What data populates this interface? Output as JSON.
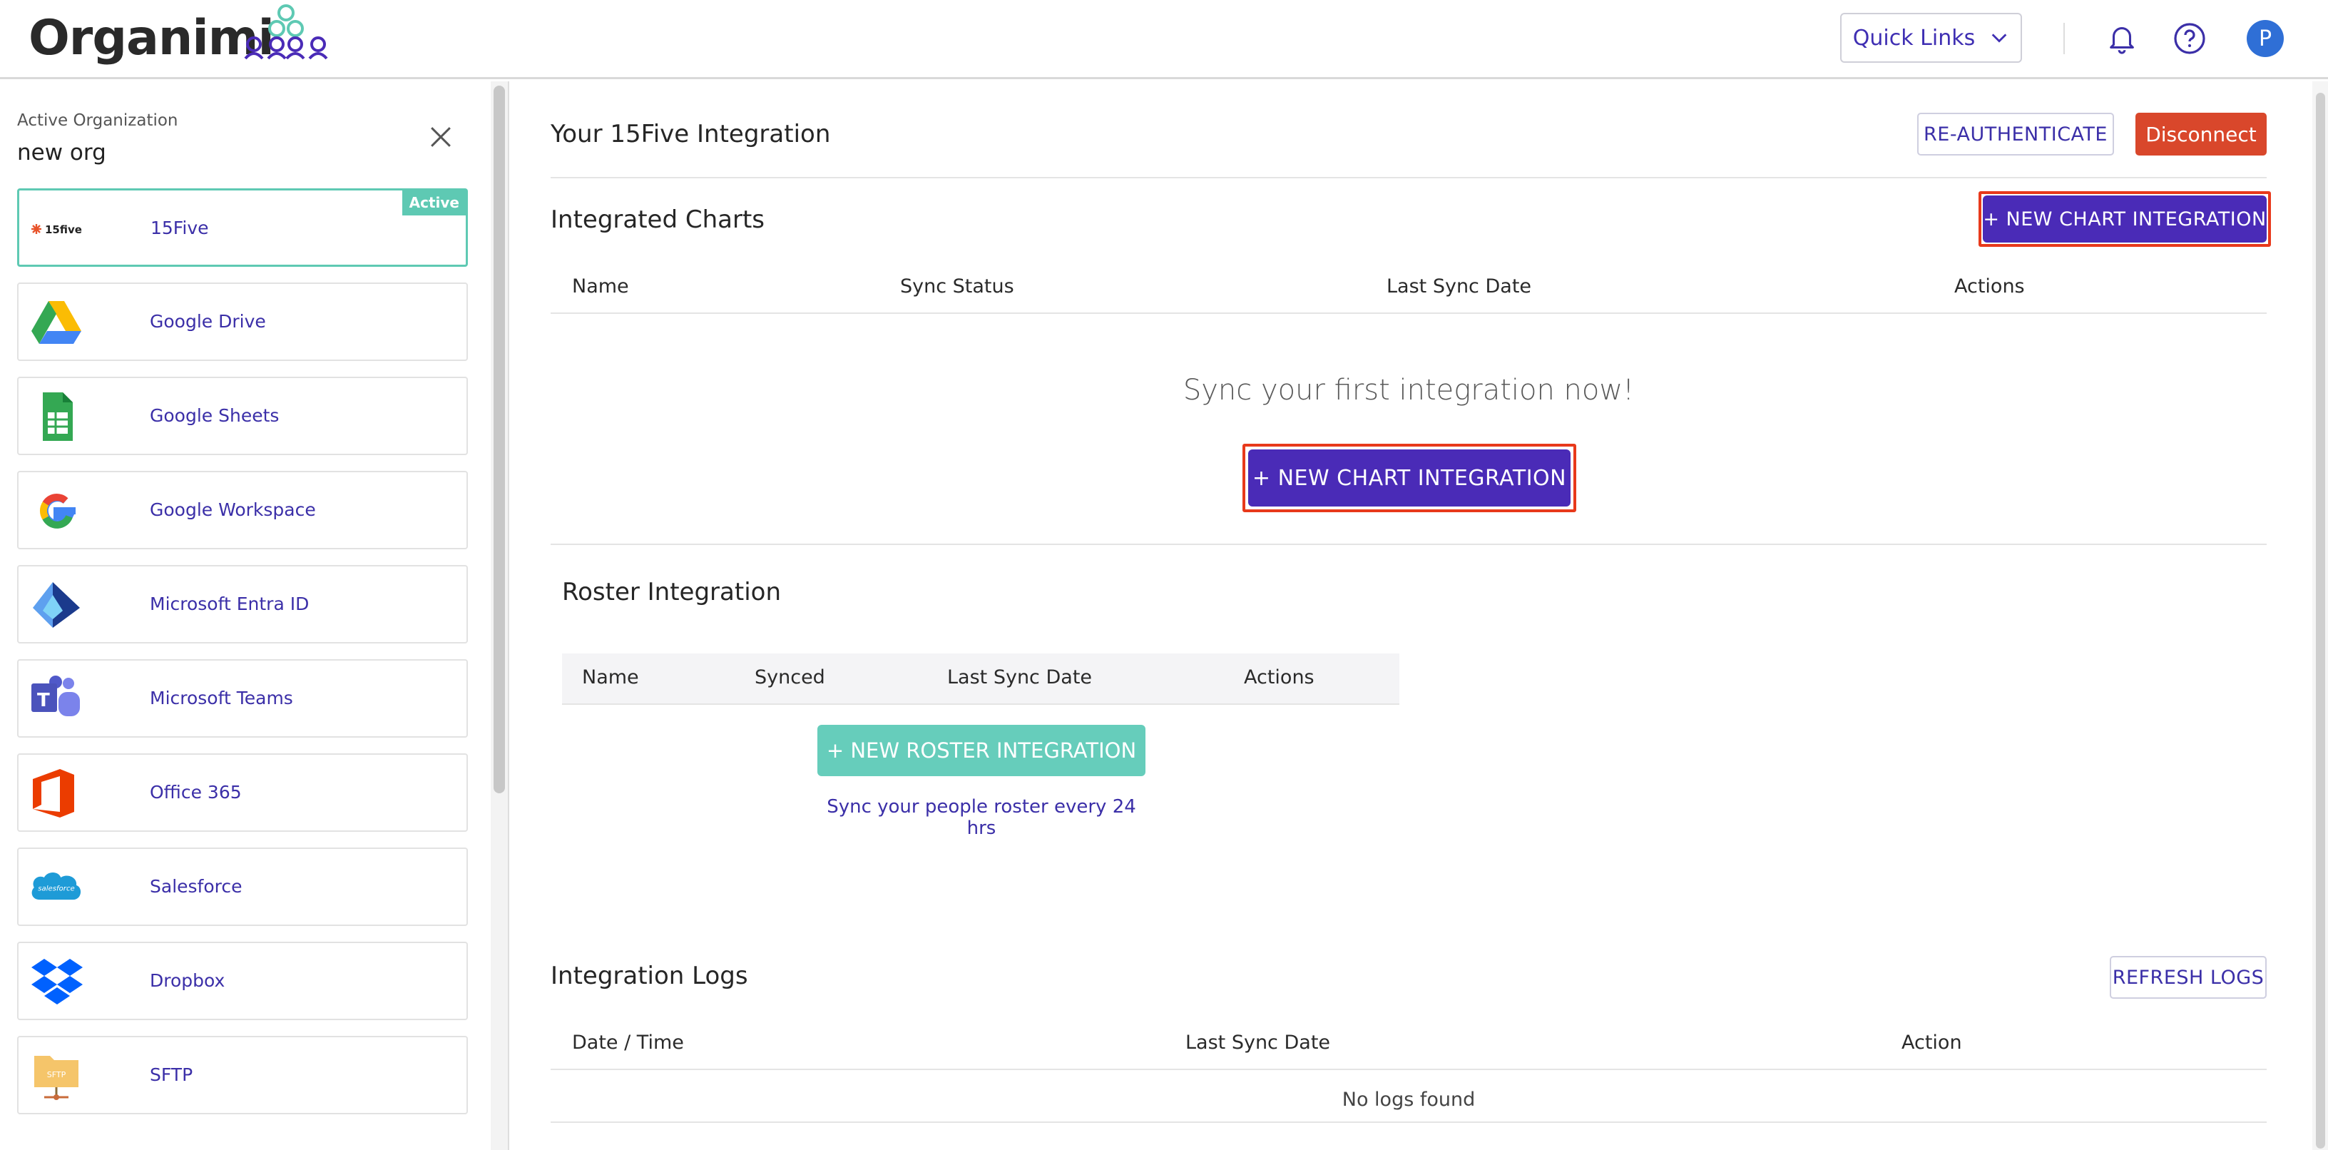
{
  "header": {
    "logo_text": "Organimi",
    "quick_links_label": "Quick Links",
    "avatar_initial": "P"
  },
  "sidebar": {
    "org_label": "Active Organization",
    "org_name": "new org",
    "active_badge": "Active",
    "items": [
      {
        "label": "15Five",
        "icon": "15five-logo-icon",
        "active": true
      },
      {
        "label": "Google Drive",
        "icon": "google-drive-icon"
      },
      {
        "label": "Google Sheets",
        "icon": "google-sheets-icon"
      },
      {
        "label": "Google Workspace",
        "icon": "google-workspace-icon"
      },
      {
        "label": "Microsoft Entra ID",
        "icon": "microsoft-entra-icon"
      },
      {
        "label": "Microsoft Teams",
        "icon": "microsoft-teams-icon"
      },
      {
        "label": "Office 365",
        "icon": "office-365-icon"
      },
      {
        "label": "Salesforce",
        "icon": "salesforce-icon"
      },
      {
        "label": "Dropbox",
        "icon": "dropbox-icon"
      },
      {
        "label": "SFTP",
        "icon": "sftp-icon"
      }
    ],
    "logo_15five_text": "15five",
    "logo_salesforce_text": "salesforce",
    "logo_sftp_text": "SFTP"
  },
  "main": {
    "title": "Your 15Five Integration",
    "reauth_label": "RE-AUTHENTICATE",
    "disconnect_label": "Disconnect",
    "charts": {
      "title": "Integrated Charts",
      "new_chart_label": "+ NEW CHART INTEGRATION",
      "columns": [
        "Name",
        "Sync Status",
        "Last Sync Date",
        "Actions"
      ],
      "empty_message": "Sync your first integration now!"
    },
    "roster": {
      "title": "Roster Integration",
      "columns": [
        "Name",
        "Synced",
        "Last Sync Date",
        "Actions"
      ],
      "new_roster_label": "+ NEW ROSTER INTEGRATION",
      "note": "Sync your people roster every 24 hrs"
    },
    "logs": {
      "title": "Integration Logs",
      "refresh_label": "REFRESH LOGS",
      "columns": [
        "Date / Time",
        "Last Sync Date",
        "Action"
      ],
      "empty_message": "No logs found"
    }
  },
  "colors": {
    "primary": "#4a2bb7",
    "danger": "#d9472b",
    "teal": "#66cdbb",
    "highlight": "#e8391b"
  }
}
